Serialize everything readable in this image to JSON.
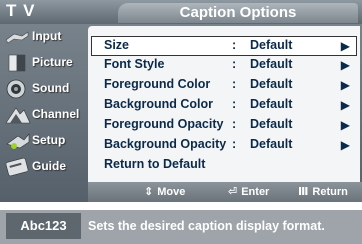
{
  "header": {
    "label": "T V",
    "title": "Caption Options"
  },
  "sidebar": {
    "items": [
      {
        "label": "Input",
        "icon": "input-icon"
      },
      {
        "label": "Picture",
        "icon": "picture-icon"
      },
      {
        "label": "Sound",
        "icon": "sound-icon"
      },
      {
        "label": "Channel",
        "icon": "channel-icon"
      },
      {
        "label": "Setup",
        "icon": "setup-icon"
      },
      {
        "label": "Guide",
        "icon": "guide-icon"
      }
    ]
  },
  "menu": {
    "rows": [
      {
        "name": "Size",
        "colon": ":",
        "value": "Default",
        "selected": true
      },
      {
        "name": "Font Style",
        "colon": ":",
        "value": "Default"
      },
      {
        "name": "Foreground Color",
        "colon": ":",
        "value": "Default"
      },
      {
        "name": "Background Color",
        "colon": ":",
        "value": "Default"
      },
      {
        "name": "Foreground Opacity",
        "colon": ":",
        "value": "Default"
      },
      {
        "name": "Background Opacity",
        "colon": ":",
        "value": "Default"
      },
      {
        "name": "Return to Default"
      }
    ]
  },
  "footer": {
    "move": "Move",
    "enter": "Enter",
    "return": "Return"
  },
  "help": {
    "tag": "Abc123",
    "text": "Sets the desired caption display format."
  },
  "colors": {
    "panel": "#f4f5f6",
    "frame": "#6b757e",
    "text": "#0b2a4a"
  }
}
